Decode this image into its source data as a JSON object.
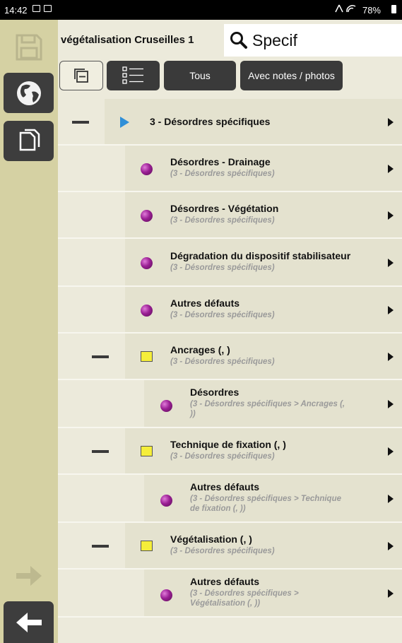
{
  "status_bar": {
    "time": "14:42",
    "battery": "78%"
  },
  "header": {
    "project_title": "végétalisation Cruseilles 1",
    "search_value": "Specif"
  },
  "toolbar": {
    "tous_label": "Tous",
    "notes_label": "Avec notes / photos"
  },
  "tree": {
    "root": {
      "title": "3 - Désordres spécifiques"
    },
    "items": [
      {
        "title": "Désordres - Drainage",
        "path": "(3 - Désordres spécifiques)"
      },
      {
        "title": "Désordres - Végétation",
        "path": "(3 - Désordres spécifiques)"
      },
      {
        "title": "Dégradation du dispositif stabilisateur",
        "path": "(3 - Désordres spécifiques)"
      },
      {
        "title": "Autres défauts",
        "path": "(3 - Désordres spécifiques)"
      },
      {
        "title": "Ancrages (, )",
        "path": "(3 - Désordres spécifiques)"
      },
      {
        "title": "Désordres",
        "path_line1": "(3 - Désordres spécifiques > Ancrages (,",
        "path_line2": "))"
      },
      {
        "title": "Technique de fixation (, )",
        "path": "(3 - Désordres spécifiques)"
      },
      {
        "title": "Autres défauts",
        "path_line1": "(3 - Désordres spécifiques > Technique",
        "path_line2": "de fixation (, ))"
      },
      {
        "title": "Végétalisation (, )",
        "path": "(3 - Désordres spécifiques)"
      },
      {
        "title": "Autres défauts",
        "path_line1": "(3 - Désordres spécifiques >",
        "path_line2": "Végétalisation (, ))"
      }
    ]
  },
  "colors": {
    "sidebar": "#d5d1a3",
    "background": "#eceadb",
    "row_body": "#e4e2cf",
    "dark_button": "#3a3a3a",
    "bullet": "#9a1f94",
    "folder_square": "#f5ee3a",
    "root_triangle": "#2f8fd8"
  }
}
